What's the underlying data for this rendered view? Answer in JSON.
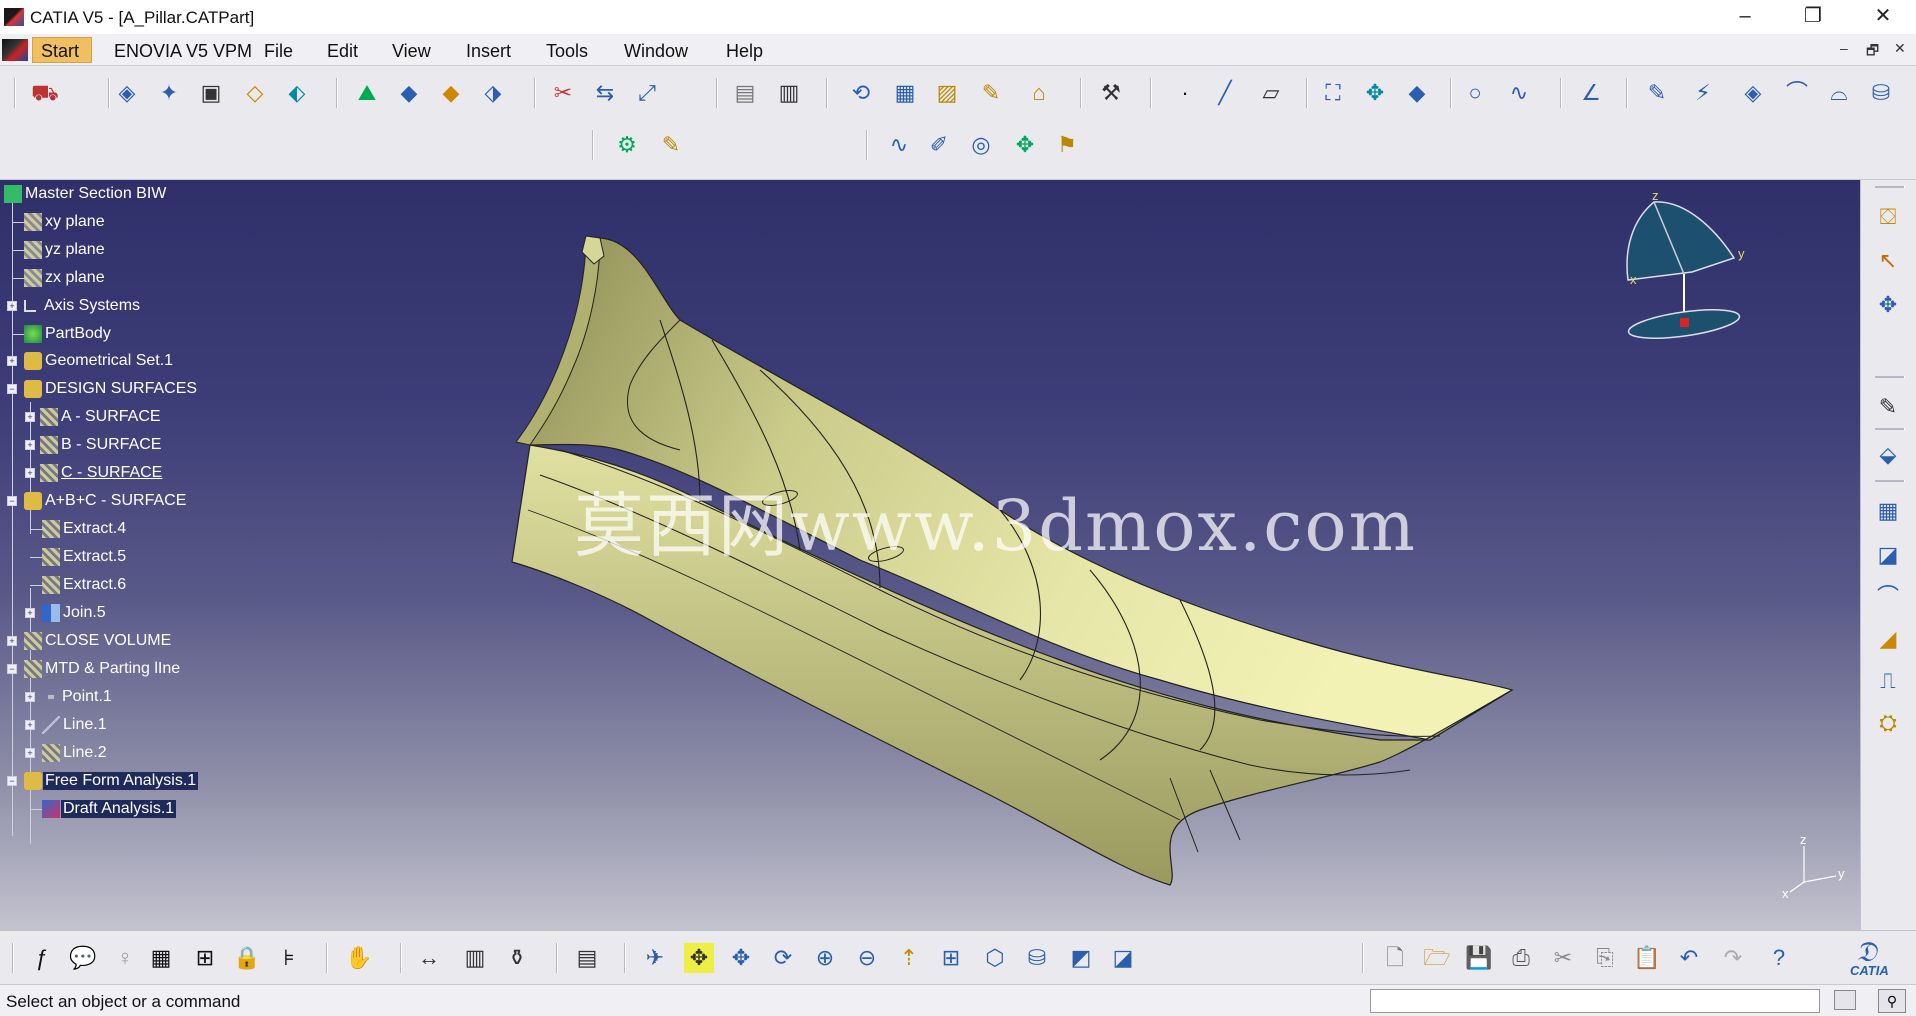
{
  "window": {
    "title": "CATIA V5 - [A_Pillar.CATPart]",
    "minimize_glyph": "–",
    "restore_glyph": "❐",
    "close_glyph": "✕"
  },
  "menu": {
    "items": [
      "Start",
      "ENOVIA V5 VPM",
      "File",
      "Edit",
      "View",
      "Insert",
      "Tools",
      "Window",
      "Help"
    ],
    "doc_controls": [
      "–",
      "🗗",
      "✕"
    ]
  },
  "tree": {
    "nodes": [
      {
        "label": "Master Section BIW"
      },
      {
        "label": "xy plane"
      },
      {
        "label": "yz plane"
      },
      {
        "label": "zx plane"
      },
      {
        "label": "Axis Systems"
      },
      {
        "label": "PartBody"
      },
      {
        "label": "Geometrical Set.1"
      },
      {
        "label": "DESIGN SURFACES"
      },
      {
        "label": "A - SURFACE"
      },
      {
        "label": "B - SURFACE"
      },
      {
        "label": "C - SURFACE"
      },
      {
        "label": "A+B+C - SURFACE"
      },
      {
        "label": "Extract.4"
      },
      {
        "label": "Extract.5"
      },
      {
        "label": "Extract.6"
      },
      {
        "label": "Join.5"
      },
      {
        "label": "CLOSE VOLUME"
      },
      {
        "label": "MTD & Parting lIne"
      },
      {
        "label": "Point.1"
      },
      {
        "label": "Line.1"
      },
      {
        "label": "Line.2"
      },
      {
        "label": "Free Form Analysis.1"
      },
      {
        "label": "Draft Analysis.1"
      }
    ]
  },
  "watermark": "莫西网www.3dmox.com",
  "compass": {
    "x": "x",
    "y": "y",
    "z": "z"
  },
  "axis_triad": {
    "x": "x",
    "y": "y",
    "z": "z"
  },
  "brand": {
    "label": "CATIA"
  },
  "status": {
    "message": "Select an object or a command"
  },
  "colors": {
    "viewport_top": "#2f2f6a",
    "viewport_bottom": "#c3c3cf",
    "part_surface": "#d8d89a",
    "highlight": "#f0c060"
  }
}
